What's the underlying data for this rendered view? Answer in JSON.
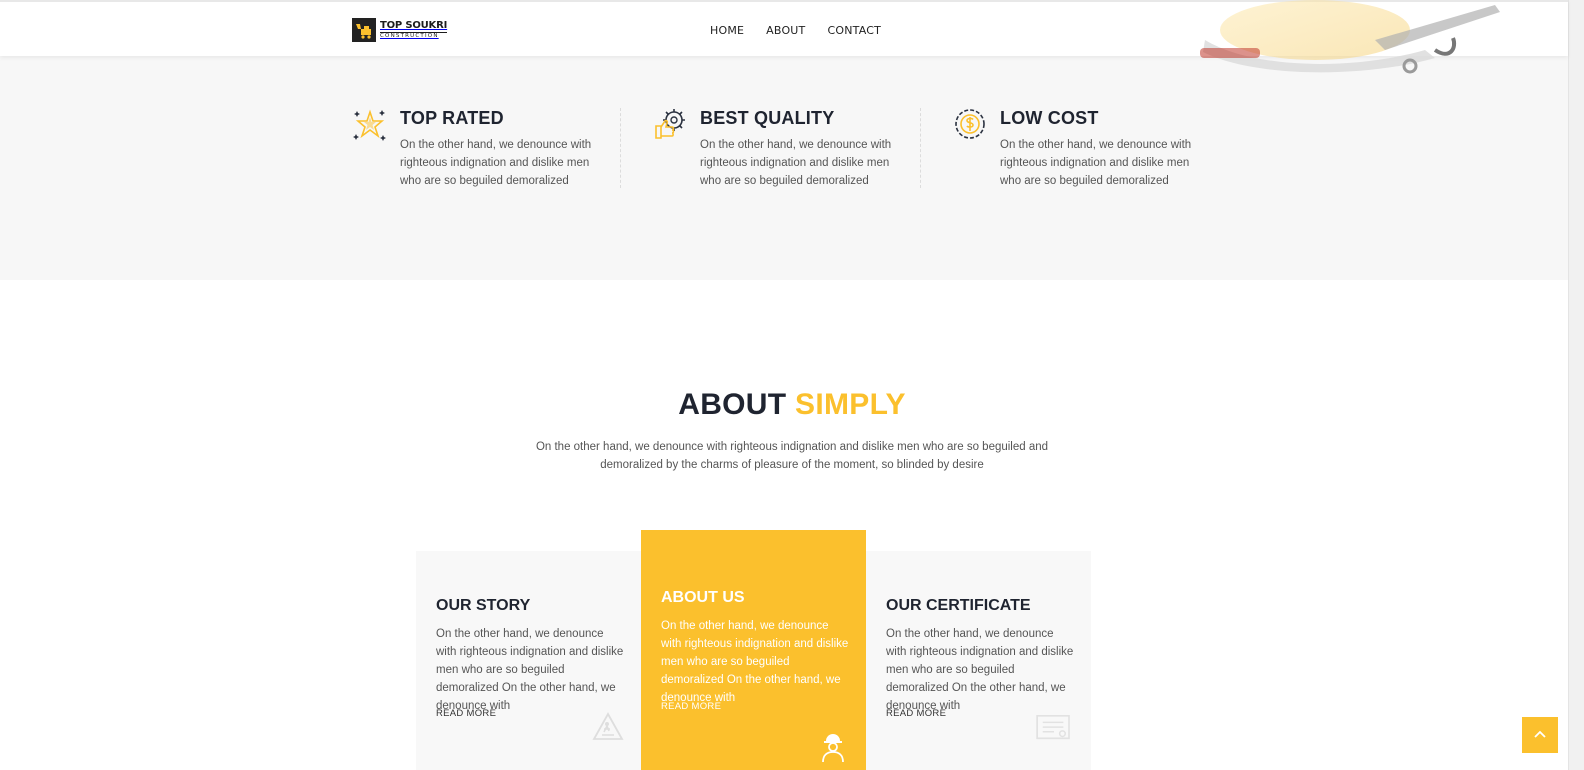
{
  "brand": {
    "name": "TOP SOUKRI",
    "tagline": "CONSTRUCTION"
  },
  "nav": {
    "items": [
      "HOME",
      "ABOUT",
      "CONTACT"
    ]
  },
  "features": [
    {
      "icon": "star-icon",
      "title": "TOP RATED",
      "text": "On the other hand, we denounce with righteous indignation and dislike men who are so beguiled demoralized"
    },
    {
      "icon": "gear-thumbs-up-icon",
      "title": "BEST QUALITY",
      "text": "On the other hand, we denounce with righteous indignation and dislike men who are so beguiled demoralized"
    },
    {
      "icon": "dollar-coin-icon",
      "title": "LOW COST",
      "text": "On the other hand, we denounce with righteous indignation and dislike men who are so beguiled demoralized"
    }
  ],
  "about": {
    "watermark": "SIMPLY",
    "title_main": "ABOUT",
    "title_accent": "SIMPLY",
    "description": "On the other hand, we denounce with righteous indignation and dislike men who are so beguiled and demoralized by the charms of pleasure of the moment, so blinded by desire"
  },
  "cards": [
    {
      "title": "OUR STORY",
      "text": "On the other hand, we denounce with righteous indignation and dislike men who are so beguiled demoralized On the other hand, we denounce with",
      "link": "READ MORE",
      "icon": "construction-sign-icon"
    },
    {
      "title": "ABOUT US",
      "text": "On the other hand, we denounce with righteous indignation and dislike men who are so beguiled demoralized On the other hand, we denounce with",
      "link": "READ MORE",
      "icon": "worker-icon"
    },
    {
      "title": "OUR CERTIFICATE",
      "text": "On the other hand, we denounce with righteous indignation and dislike men who are so beguiled demoralized On the other hand, we denounce with",
      "link": "READ MORE",
      "icon": "certificate-icon"
    }
  ],
  "colors": {
    "accent": "#fbc02d",
    "dark": "#1f2430",
    "band": "#f7f7f7"
  },
  "back_to_top": {
    "icon": "chevron-up-icon"
  }
}
